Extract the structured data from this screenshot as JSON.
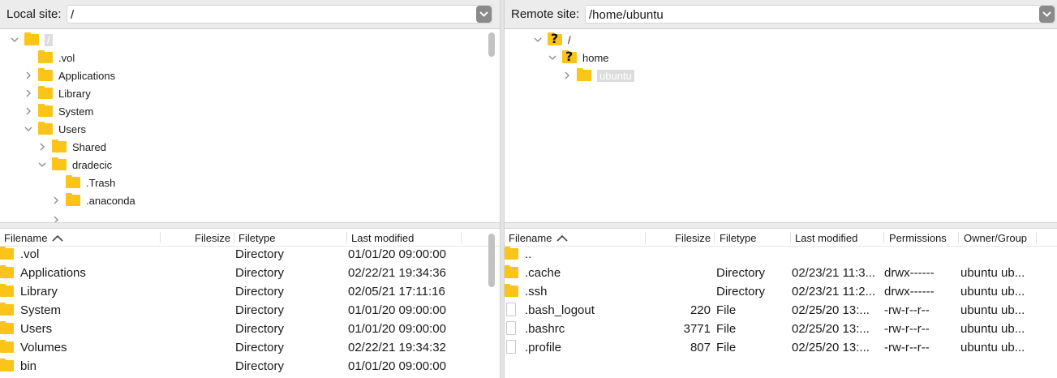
{
  "local": {
    "label": "Local site:",
    "path": "/",
    "tree": [
      {
        "label": "/",
        "chevron": "down",
        "depth": 0,
        "selected": true,
        "icon": "folder-icon"
      },
      {
        "label": ".vol",
        "chevron": "",
        "depth": 1,
        "icon": "folder-icon"
      },
      {
        "label": "Applications",
        "chevron": "right",
        "depth": 1,
        "icon": "folder-icon"
      },
      {
        "label": "Library",
        "chevron": "right",
        "depth": 1,
        "icon": "folder-icon"
      },
      {
        "label": "System",
        "chevron": "right",
        "depth": 1,
        "icon": "folder-icon"
      },
      {
        "label": "Users",
        "chevron": "down",
        "depth": 1,
        "icon": "folder-icon"
      },
      {
        "label": "Shared",
        "chevron": "right",
        "depth": 2,
        "icon": "folder-icon"
      },
      {
        "label": "dradecic",
        "chevron": "down",
        "depth": 2,
        "icon": "folder-icon"
      },
      {
        "label": ".Trash",
        "chevron": "",
        "depth": 3,
        "icon": "folder-icon"
      },
      {
        "label": ".anaconda",
        "chevron": "right",
        "depth": 3,
        "icon": "folder-icon"
      }
    ],
    "columns": {
      "filename": "Filename",
      "filesize": "Filesize",
      "filetype": "Filetype",
      "modified": "Last modified"
    },
    "files": [
      {
        "name": ".vol",
        "size": "",
        "type": "Directory",
        "modified": "01/01/20 09:00:00"
      },
      {
        "name": "Applications",
        "size": "",
        "type": "Directory",
        "modified": "02/22/21 19:34:36"
      },
      {
        "name": "Library",
        "size": "",
        "type": "Directory",
        "modified": "02/05/21 17:11:16"
      },
      {
        "name": "System",
        "size": "",
        "type": "Directory",
        "modified": "01/01/20 09:00:00"
      },
      {
        "name": "Users",
        "size": "",
        "type": "Directory",
        "modified": "01/01/20 09:00:00"
      },
      {
        "name": "Volumes",
        "size": "",
        "type": "Directory",
        "modified": "02/22/21 19:34:32"
      },
      {
        "name": "bin",
        "size": "",
        "type": "Directory",
        "modified": "01/01/20 09:00:00"
      }
    ]
  },
  "remote": {
    "label": "Remote site:",
    "path": "/home/ubuntu",
    "tree": [
      {
        "label": "/",
        "chevron": "down",
        "depth": 0,
        "icon": "unknown-folder-icon"
      },
      {
        "label": "home",
        "chevron": "down",
        "depth": 1,
        "icon": "unknown-folder-icon"
      },
      {
        "label": "ubuntu",
        "chevron": "right",
        "depth": 2,
        "selected": true,
        "icon": "folder-icon"
      }
    ],
    "columns": {
      "filename": "Filename",
      "filesize": "Filesize",
      "filetype": "Filetype",
      "modified": "Last modified",
      "permissions": "Permissions",
      "owner": "Owner/Group"
    },
    "files": [
      {
        "name": "..",
        "size": "",
        "type": "",
        "modified": "",
        "permissions": "",
        "owner": "",
        "icon": "folder-icon"
      },
      {
        "name": ".cache",
        "size": "",
        "type": "Directory",
        "modified": "02/23/21 11:3...",
        "permissions": "drwx------",
        "owner": "ubuntu ub...",
        "icon": "folder-icon"
      },
      {
        "name": ".ssh",
        "size": "",
        "type": "Directory",
        "modified": "02/23/21 11:2...",
        "permissions": "drwx------",
        "owner": "ubuntu ub...",
        "icon": "folder-icon"
      },
      {
        "name": ".bash_logout",
        "size": "220",
        "type": "File",
        "modified": "02/25/20 13:...",
        "permissions": "-rw-r--r--",
        "owner": "ubuntu ub...",
        "icon": "file-icon"
      },
      {
        "name": ".bashrc",
        "size": "3771",
        "type": "File",
        "modified": "02/25/20 13:...",
        "permissions": "-rw-r--r--",
        "owner": "ubuntu ub...",
        "icon": "file-icon"
      },
      {
        "name": ".profile",
        "size": "807",
        "type": "File",
        "modified": "02/25/20 13:...",
        "permissions": "-rw-r--r--",
        "owner": "ubuntu ub...",
        "icon": "file-icon"
      }
    ]
  }
}
